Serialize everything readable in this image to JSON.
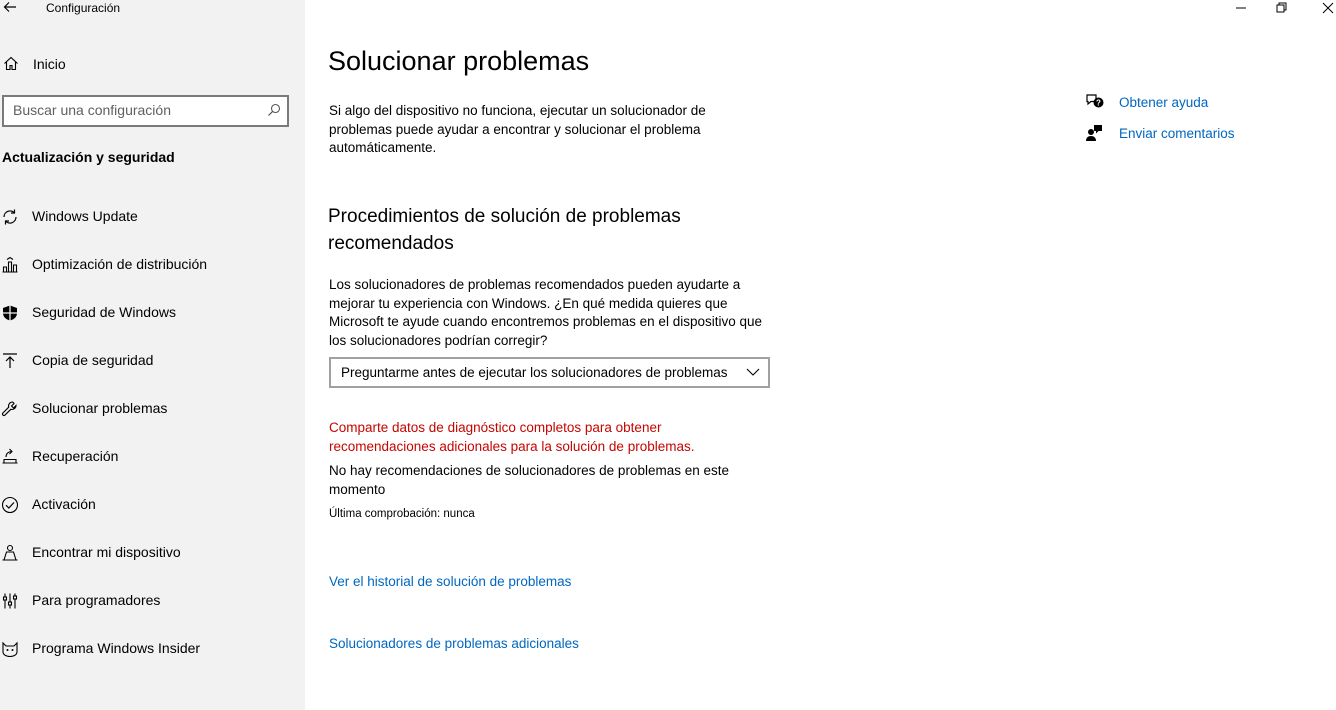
{
  "window": {
    "title": "Configuración"
  },
  "sidebar": {
    "home_label": "Inicio",
    "search_placeholder": "Buscar una configuración",
    "section_title": "Actualización y seguridad",
    "items": [
      {
        "label": "Windows Update",
        "icon": "sync-icon"
      },
      {
        "label": "Optimización de distribución",
        "icon": "delivery-optimization-icon"
      },
      {
        "label": "Seguridad de Windows",
        "icon": "shield-icon"
      },
      {
        "label": "Copia de seguridad",
        "icon": "backup-arrow-icon"
      },
      {
        "label": "Solucionar problemas",
        "icon": "wrench-icon"
      },
      {
        "label": "Recuperación",
        "icon": "recovery-icon"
      },
      {
        "label": "Activación",
        "icon": "check-circle-icon"
      },
      {
        "label": "Encontrar mi dispositivo",
        "icon": "person-location-icon"
      },
      {
        "label": "Para programadores",
        "icon": "developer-tools-icon"
      },
      {
        "label": "Programa Windows Insider",
        "icon": "insider-cat-icon"
      }
    ]
  },
  "main": {
    "title": "Solucionar problemas",
    "intro": "Si algo del dispositivo no funciona, ejecutar un solucionador de problemas puede ayudar a encontrar y solucionar el problema automáticamente.",
    "recommended_heading": "Procedimientos de solución de problemas recomendados",
    "recommended_text": "Los solucionadores de problemas recomendados pueden ayudarte a mejorar tu experiencia con Windows. ¿En qué medida quieres que Microsoft te ayude cuando encontremos problemas en el dispositivo que los solucionadores podrían corregir?",
    "dropdown_value": "Preguntarme antes de ejecutar los solucionadores de problemas",
    "diagnostic_warning": "Comparte datos de diagnóstico completos para obtener recomendaciones adicionales para la solución de problemas.",
    "no_recommendations": "No hay recomendaciones de solucionadores de problemas en este momento",
    "last_check": "Última comprobación: nunca",
    "history_link": "Ver el historial de solución de problemas",
    "additional_link": "Solucionadores de problemas adicionales"
  },
  "right_panel": {
    "help_label": "Obtener ayuda",
    "feedback_label": "Enviar comentarios"
  },
  "colors": {
    "sidebar_bg": "#f2f2f2",
    "link": "#0067c0",
    "warning": "#c50500"
  }
}
